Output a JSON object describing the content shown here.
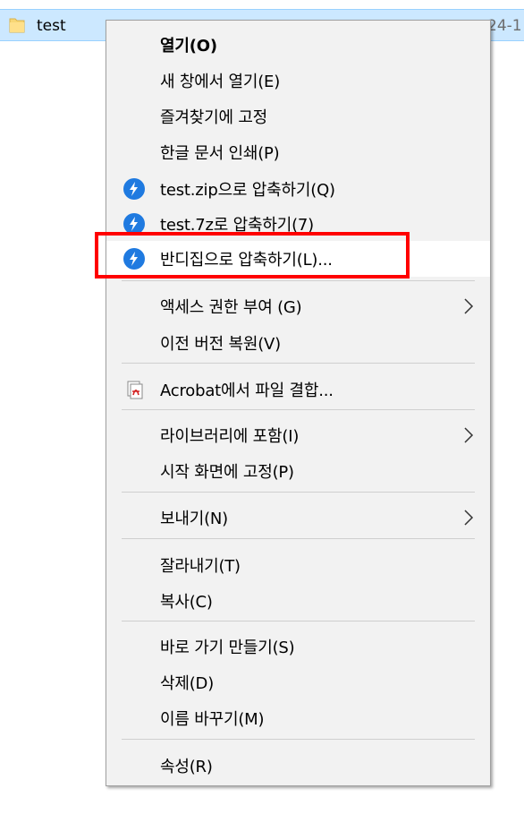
{
  "file_row": {
    "name": "test",
    "date_fragment": "24-1"
  },
  "menu": {
    "items": [
      {
        "label": "열기(O)",
        "icon": null,
        "submenu": false
      },
      {
        "label": "새 창에서 열기(E)",
        "icon": null,
        "submenu": false
      },
      {
        "label": "즐겨찾기에 고정",
        "icon": null,
        "submenu": false
      },
      {
        "label": "한글 문서 인쇄(P)",
        "icon": null,
        "submenu": false
      },
      {
        "label": "test.zip으로 압축하기(Q)",
        "icon": "bandizip-icon",
        "submenu": false
      },
      {
        "label": "test.7z로 압축하기(7)",
        "icon": "bandizip-icon",
        "submenu": false
      },
      {
        "label": "반디집으로 압축하기(L)...",
        "icon": "bandizip-icon",
        "submenu": false
      },
      {
        "label": "액세스 권한 부여 (G)",
        "icon": null,
        "submenu": true
      },
      {
        "label": "이전 버전 복원(V)",
        "icon": null,
        "submenu": false
      },
      {
        "label": "Acrobat에서 파일 결합...",
        "icon": "acrobat-icon",
        "submenu": false
      },
      {
        "label": "라이브러리에 포함(I)",
        "icon": null,
        "submenu": true
      },
      {
        "label": "시작 화면에 고정(P)",
        "icon": null,
        "submenu": false
      },
      {
        "label": "보내기(N)",
        "icon": null,
        "submenu": true
      },
      {
        "label": "잘라내기(T)",
        "icon": null,
        "submenu": false
      },
      {
        "label": "복사(C)",
        "icon": null,
        "submenu": false
      },
      {
        "label": "바로 가기 만들기(S)",
        "icon": null,
        "submenu": false
      },
      {
        "label": "삭제(D)",
        "icon": null,
        "submenu": false
      },
      {
        "label": "이름 바꾸기(M)",
        "icon": null,
        "submenu": false
      },
      {
        "label": "속성(R)",
        "icon": null,
        "submenu": false
      }
    ]
  },
  "colors": {
    "selection_bg": "#cce8ff",
    "menu_bg": "#f2f2f2",
    "highlight_box": "#ff0000",
    "bandizip_blue": "#1f7ae0"
  }
}
